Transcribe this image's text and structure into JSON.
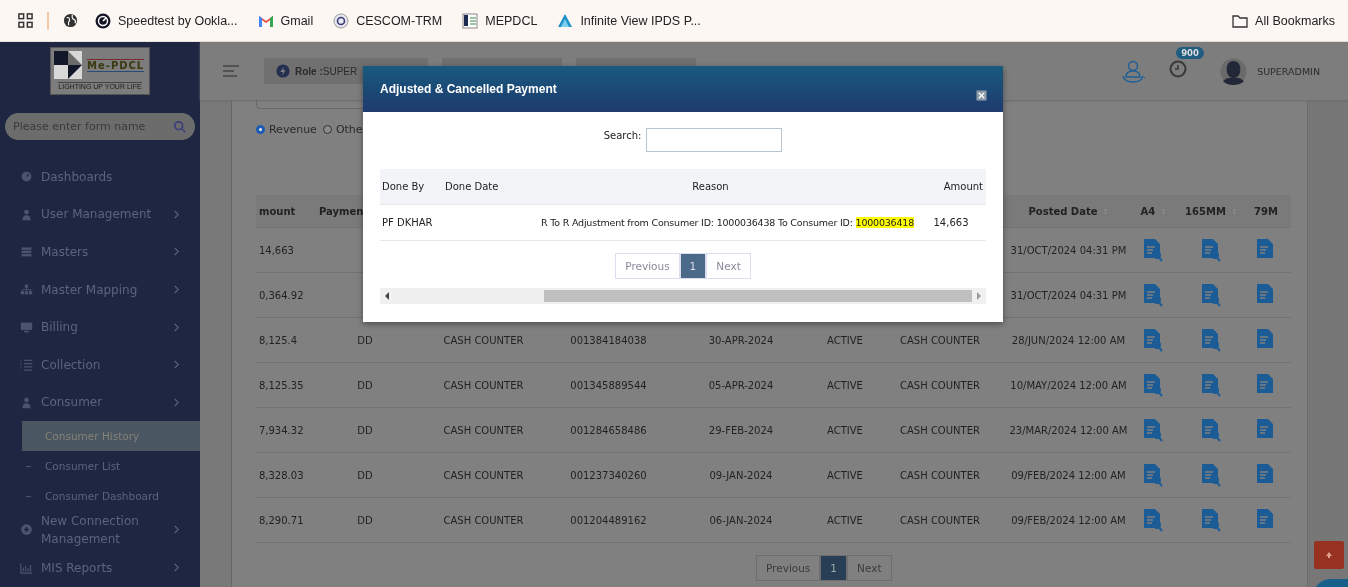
{
  "bookmarks_bar": {
    "items": [
      {
        "label": "Speedtest by Ookla..."
      },
      {
        "label": "Gmail"
      },
      {
        "label": "CESCOM-TRM"
      },
      {
        "label": "MEPDCL"
      },
      {
        "label": "Infinite View IPDS P..."
      }
    ],
    "all_bookmarks": "All Bookmarks"
  },
  "sidebar": {
    "logo": {
      "name": "Me-PDCL",
      "tagline": "LIGHTING UP YOUR LIFE"
    },
    "search": {
      "placeholder": "Please enter form name"
    },
    "items": [
      {
        "label": "Dashboards",
        "expandable": false
      },
      {
        "label": "User Management",
        "expandable": true
      },
      {
        "label": "Masters",
        "expandable": true
      },
      {
        "label": "Master Mapping",
        "expandable": true
      },
      {
        "label": "Billing",
        "expandable": true
      },
      {
        "label": "Collection",
        "expandable": true
      },
      {
        "label": "Consumer",
        "expandable": true,
        "children": [
          {
            "label": "Consumer History",
            "selected": true
          },
          {
            "label": "Consumer List",
            "selected": false
          },
          {
            "label": "Consumer Dashboard",
            "selected": false
          }
        ]
      },
      {
        "label": "New Connection Management",
        "expandable": true
      },
      {
        "label": "MIS Reports",
        "expandable": true
      }
    ]
  },
  "header": {
    "role_label": "Role :",
    "role_value": "SUPER",
    "notification_count": "900",
    "user": "SUPERADMIN"
  },
  "filters": {
    "radios": [
      {
        "label": "Revenue",
        "selected": true
      },
      {
        "label": "Othe",
        "selected": false
      }
    ]
  },
  "table": {
    "columns": [
      "mount",
      "Paymen"
    ],
    "columns_tail": [
      "Posted Date",
      "A4",
      "165MM",
      "79M"
    ],
    "rows": [
      {
        "cells": [
          "14,663"
        ],
        "tail": [
          "31/OCT/2024 04:31 PM"
        ]
      },
      {
        "cells": [
          "0,364.92"
        ],
        "tail": [
          "31/OCT/2024 04:31 PM"
        ]
      },
      {
        "cells": [
          "8,125.4",
          "DD",
          "CASH COUNTER",
          "001384184038",
          "30-APR-2024",
          "ACTIVE",
          "CASH COUNTER",
          "28/JUN/2024 12:00 AM"
        ]
      },
      {
        "cells": [
          "8,125.35",
          "DD",
          "CASH COUNTER",
          "001345889544",
          "05-APR-2024",
          "ACTIVE",
          "CASH COUNTER",
          "10/MAY/2024 12:00 AM"
        ]
      },
      {
        "cells": [
          "7,934.32",
          "DD",
          "CASH COUNTER",
          "001284658486",
          "29-FEB-2024",
          "ACTIVE",
          "CASH COUNTER",
          "23/MAR/2024 12:00 AM"
        ]
      },
      {
        "cells": [
          "8,328.03",
          "DD",
          "CASH COUNTER",
          "001237340260",
          "09-JAN-2024",
          "ACTIVE",
          "CASH COUNTER",
          "09/FEB/2024 12:00 AM"
        ]
      },
      {
        "cells": [
          "8,290.71",
          "DD",
          "CASH COUNTER",
          "001204489162",
          "06-JAN-2024",
          "ACTIVE",
          "CASH COUNTER",
          "09/FEB/2024 12:00 AM"
        ]
      }
    ],
    "pagination": [
      {
        "label": "Previous",
        "selected": false
      },
      {
        "label": "1",
        "selected": true
      },
      {
        "label": "Next",
        "selected": false
      }
    ]
  },
  "modal": {
    "title": "Adjusted & Cancelled Payment",
    "search_label": "Search:",
    "columns": [
      "Done By",
      "Done Date",
      "Reason",
      "Amount"
    ],
    "rows": [
      {
        "done_by": "PF DKHAR",
        "reason": "R To R Adjustment from Consumer ID: 1000036438 To Consumer ID: ",
        "reason_highlight": "1000036418",
        "amount": "14,663"
      }
    ],
    "pagination": [
      {
        "label": "Previous",
        "selected": false
      },
      {
        "label": "1",
        "selected": true
      },
      {
        "label": "Next",
        "selected": false
      }
    ]
  }
}
